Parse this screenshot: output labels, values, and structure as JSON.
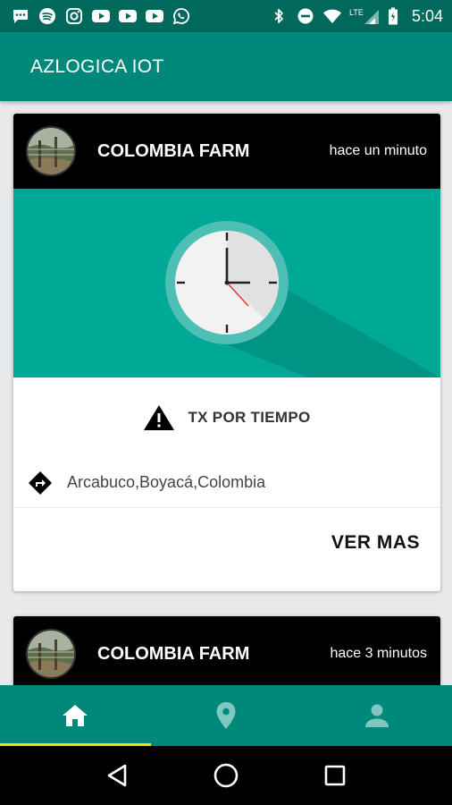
{
  "status_bar": {
    "time": "5:04",
    "network": "LTE",
    "left_icons": [
      "chat-icon",
      "spotify-icon",
      "instagram-icon",
      "youtube-icon",
      "youtube-icon",
      "youtube-icon",
      "whatsapp-icon"
    ],
    "right_icons": [
      "bluetooth-icon",
      "do-not-disturb-icon",
      "wifi-icon",
      "lte-signal-icon",
      "battery-icon"
    ]
  },
  "app_bar": {
    "title": "AZLOGICA IOT"
  },
  "cards": [
    {
      "farm_name": "COLOMBIA FARM",
      "time_ago": "hace un minuto",
      "alert_label": "TX POR TIEMPO",
      "location": "Arcabuco,Boyacá,Colombia",
      "more_label": "VER MAS"
    },
    {
      "farm_name": "COLOMBIA FARM",
      "time_ago": "hace 3 minutos"
    }
  ],
  "bottom_nav": {
    "items": [
      {
        "icon": "home-icon",
        "active": true
      },
      {
        "icon": "location-pin-icon",
        "active": false
      },
      {
        "icon": "person-icon",
        "active": false
      }
    ],
    "active_indicator_color": "#e6e600"
  },
  "colors": {
    "status_bar": "#00695c",
    "app_bar": "#00897b",
    "clock_background": "#00a896",
    "card_header": "#000000"
  }
}
